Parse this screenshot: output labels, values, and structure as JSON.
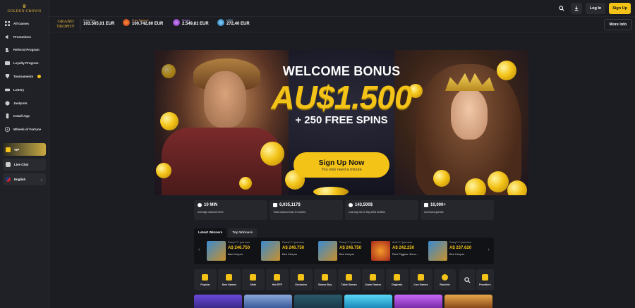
{
  "brand": {
    "name": "GOLDEN CROWN"
  },
  "sidebar": {
    "items": [
      {
        "label": "All Games",
        "icon": "grid-icon"
      },
      {
        "label": "Promotions",
        "icon": "megaphone-icon"
      },
      {
        "label": "Referral Program",
        "icon": "referral-icon"
      },
      {
        "label": "Loyalty Program",
        "icon": "loyalty-icon"
      },
      {
        "label": "Tournaments",
        "icon": "trophy-icon"
      },
      {
        "label": "Lottery",
        "icon": "ticket-icon"
      },
      {
        "label": "Jackpots",
        "icon": "jackpot-icon"
      },
      {
        "label": "Install App",
        "icon": "phone-icon"
      },
      {
        "label": "Wheels of Fortune",
        "icon": "wheel-icon"
      }
    ],
    "vip_label": "VIP",
    "chat_label": "Live Chat",
    "language_label": "English"
  },
  "header": {
    "login_label": "Log In",
    "signup_label": "Sign Up"
  },
  "jackpots": {
    "grand_trophy_line1": "GRAND",
    "grand_trophy_line2": "TROPHY",
    "items": [
      {
        "label": "Prize Pool",
        "value": "103.565,01 EUR"
      },
      {
        "label": "Prize Network",
        "value": "100.742,80 EUR"
      },
      {
        "label": "Mobile",
        "value": "2.549,81 EUR"
      },
      {
        "label": "NEW",
        "value": "272,40 EUR"
      }
    ],
    "more_info_label": "More Info"
  },
  "hero": {
    "title": "WELCOME BONUS",
    "amount": "AU$1.500",
    "spins": "+ 250 FREE SPINS",
    "cta_label": "Sign Up Now",
    "cta_sub": "You only need a minute"
  },
  "stats": [
    {
      "value": "10 MIN",
      "desc": "Average cashout time."
    },
    {
      "value": "6,035,117$",
      "desc": "Total cashout last 3 months"
    },
    {
      "value": "143,500$",
      "desc": "Last big win in Big Wild Buffalo"
    },
    {
      "value": "10,000+",
      "desc": "Licensed games"
    }
  ],
  "winners": {
    "tabs": [
      "Latest Winners",
      "Top Winners"
    ],
    "items": [
      {
        "who": "Pasq***** just won",
        "amount": "A$ 246.750",
        "game": "Bee Keeper",
        "color": "#c8902a"
      },
      {
        "who": "Pasq***** just won",
        "amount": "A$ 246.750",
        "game": "Bee Keeper",
        "color": "#c8902a"
      },
      {
        "who": "Pasq***** just won",
        "amount": "A$ 246.750",
        "game": "Bee Keeper",
        "color": "#c8902a"
      },
      {
        "who": "Ant***** just won",
        "amount": "A$ 242.250",
        "game": "Rich Piggies: Bonu...",
        "color": "#d4481a"
      },
      {
        "who": "Pasq***** just won",
        "amount": "A$ 237.620",
        "game": "Bee Keeper",
        "color": "#c8902a"
      }
    ]
  },
  "categories": [
    "Popular",
    "New Games",
    "Slots",
    "Hot RTP",
    "Exclusive",
    "Bonus Buy",
    "Table Games",
    "Crash Games",
    "Originals",
    "Live Games",
    "Roulette"
  ],
  "providers_label": "Providers",
  "game_tile_colors": [
    "#4b2fb0",
    "#2a5a9a",
    "#1a4a5a",
    "#2ab0d8",
    "#b03ad0",
    "#c87a2a"
  ]
}
